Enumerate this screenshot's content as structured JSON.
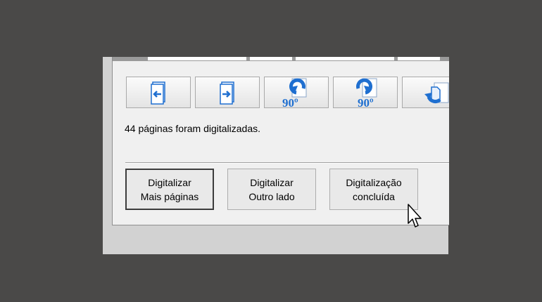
{
  "colors": {
    "background": "#4a4948",
    "dialog": "#f0f0f0",
    "icon_blue": "#1f6fd0"
  },
  "toolbar": {
    "buttons": [
      {
        "name": "move-page-left-button",
        "icon": "page-arrow-left-icon"
      },
      {
        "name": "move-page-right-button",
        "icon": "page-arrow-right-icon"
      },
      {
        "name": "rotate-left-90-button",
        "icon": "rotate-left-icon",
        "label": "90º"
      },
      {
        "name": "rotate-right-90-button",
        "icon": "rotate-right-icon",
        "label": "90º"
      },
      {
        "name": "flip-page-button",
        "icon": "flip-page-icon"
      }
    ]
  },
  "status": {
    "text": "44 páginas foram digitalizadas."
  },
  "actions": {
    "scan_more": {
      "line1": "Digitalizar",
      "line2": "Mais páginas"
    },
    "scan_other_side": {
      "line1": "Digitalizar",
      "line2": "Outro lado"
    },
    "scan_done": {
      "line1": "Digitalização",
      "line2": "concluída"
    }
  }
}
